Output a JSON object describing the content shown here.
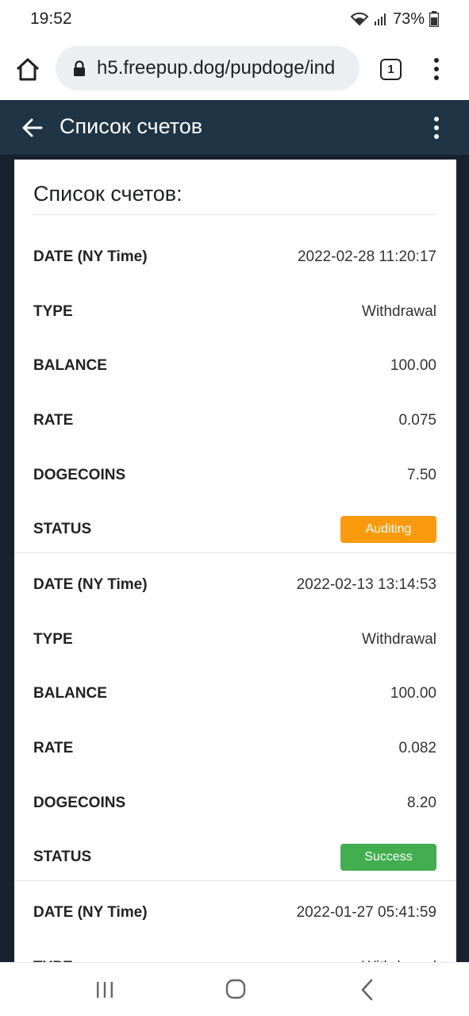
{
  "status_bar": {
    "time": "19:52",
    "battery": "73%"
  },
  "browser": {
    "url": "h5.freepup.dog/pupdoge/ind",
    "tab_count": "1"
  },
  "header": {
    "title": "Список счетов"
  },
  "card": {
    "title": "Список счетов:",
    "labels": {
      "date": "DATE (NY Time)",
      "type": "TYPE",
      "balance": "BALANCE",
      "rate": "RATE",
      "dogecoins": "DOGECOINS",
      "status": "STATUS"
    },
    "records": [
      {
        "date": "2022-02-28 11:20:17",
        "type": "Withdrawal",
        "balance": "100.00",
        "rate": "0.075",
        "dogecoins": "7.50",
        "status": "Auditing",
        "status_color": "#fb9a0e"
      },
      {
        "date": "2022-02-13 13:14:53",
        "type": "Withdrawal",
        "balance": "100.00",
        "rate": "0.082",
        "dogecoins": "8.20",
        "status": "Success",
        "status_color": "#42ae4f"
      },
      {
        "date": "2022-01-27 05:41:59",
        "type": "Withdrawal"
      }
    ]
  },
  "colors": {
    "header_bg": "#1f3444",
    "page_bg": "#17212f",
    "auditing": "#fb9a0e",
    "success": "#42ae4f"
  },
  "icons": [
    "wifi-icon",
    "signal-icon",
    "battery-icon",
    "home-icon",
    "lock-icon",
    "kebab-menu-icon",
    "back-arrow-icon",
    "recents-icon",
    "nav-home-icon",
    "nav-back-icon"
  ]
}
